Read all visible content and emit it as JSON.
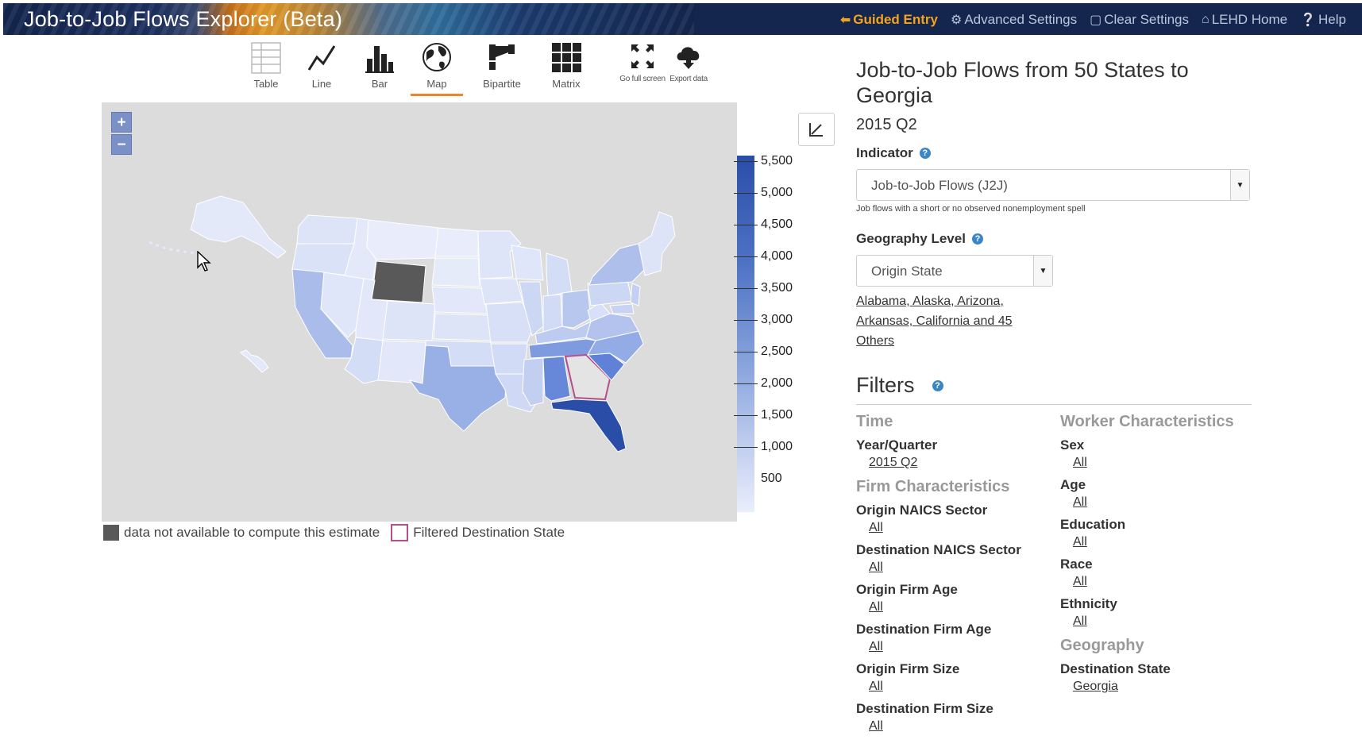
{
  "header": {
    "title": "Job-to-Job Flows Explorer (Beta)",
    "nav": [
      {
        "label": "Guided Entry",
        "icon": "arrow-left-icon",
        "glyph": "⬅"
      },
      {
        "label": "Advanced Settings",
        "icon": "gear-icon",
        "glyph": "⚙"
      },
      {
        "label": "Clear Settings",
        "icon": "trash-icon",
        "glyph": "🗑"
      },
      {
        "label": "LEHD Home",
        "icon": "home-icon",
        "glyph": "⌂"
      },
      {
        "label": "Help",
        "icon": "help-circle-icon",
        "glyph": "?"
      }
    ]
  },
  "toolbar": {
    "tools": [
      {
        "label": "Table",
        "icon": "table-icon"
      },
      {
        "label": "Line",
        "icon": "line-chart-icon"
      },
      {
        "label": "Bar",
        "icon": "bar-chart-icon"
      },
      {
        "label": "Map",
        "icon": "globe-icon",
        "active": true
      },
      {
        "label": "Bipartite",
        "icon": "bipartite-icon"
      },
      {
        "label": "Matrix",
        "icon": "matrix-icon"
      },
      {
        "label": "Go full screen",
        "icon": "fullscreen-icon"
      },
      {
        "label": "Export data",
        "icon": "cloud-download-icon"
      }
    ]
  },
  "map": {
    "zoom_in": "+",
    "zoom_out": "−",
    "legend_ticks": [
      "5,500",
      "5,000",
      "4,500",
      "4,000",
      "3,500",
      "3,000",
      "2,500",
      "2,000",
      "1,500",
      "1,000",
      "500"
    ],
    "legend_na": "data not available to compute this estimate",
    "legend_filtered": "Filtered Destination State",
    "colors": {
      "na": "#595959",
      "filtered_outline": "#b3508a",
      "high": "#2a4ea8",
      "low": "#e9eefb"
    }
  },
  "panel": {
    "title": "Job-to-Job Flows from 50 States to Georgia",
    "period": "2015 Q2",
    "indicator_label": "Indicator",
    "indicator_value": "Job-to-Job Flows (J2J)",
    "indicator_note": "Job flows with a short or no observed nonemployment spell",
    "geo_label": "Geography Level",
    "geo_value": "Origin State",
    "geo_links": "Alabama, Alaska, Arizona, Arkansas, California and 45 Others",
    "filters_title": "Filters"
  },
  "filters": {
    "time": {
      "heading": "Time",
      "year_label": "Year/Quarter",
      "year_value": "2015 Q2"
    },
    "firm": {
      "heading": "Firm Characteristics",
      "items": [
        {
          "label": "Origin NAICS Sector",
          "value": "All"
        },
        {
          "label": "Destination NAICS Sector",
          "value": "All"
        },
        {
          "label": "Origin Firm Age",
          "value": "All"
        },
        {
          "label": "Destination Firm Age",
          "value": "All"
        },
        {
          "label": "Origin Firm Size",
          "value": "All"
        },
        {
          "label": "Destination Firm Size",
          "value": "All"
        }
      ]
    },
    "worker": {
      "heading": "Worker Characteristics",
      "items": [
        {
          "label": "Sex",
          "value": "All"
        },
        {
          "label": "Age",
          "value": "All"
        },
        {
          "label": "Education",
          "value": "All"
        },
        {
          "label": "Race",
          "value": "All"
        },
        {
          "label": "Ethnicity",
          "value": "All"
        }
      ]
    },
    "geography": {
      "heading": "Geography",
      "label": "Destination State",
      "value": "Georgia"
    }
  }
}
